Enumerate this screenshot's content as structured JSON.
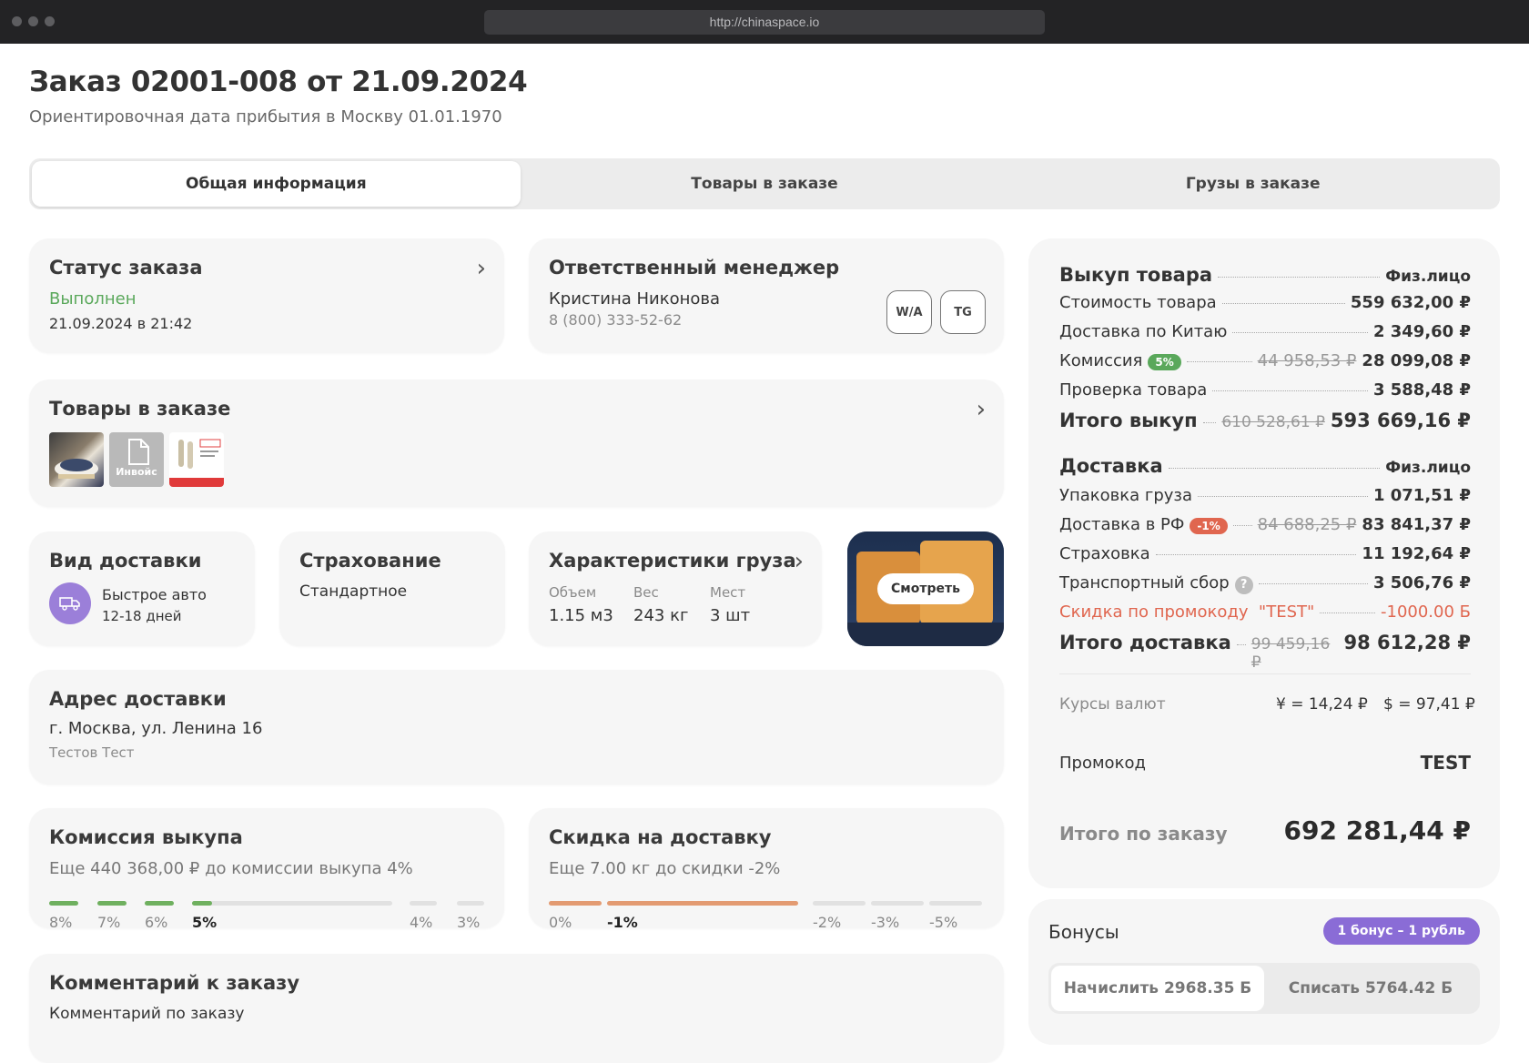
{
  "browser": {
    "url": "http://chinaspace.io"
  },
  "header": {
    "title": "Заказ 02001-008 от 21.09.2024",
    "subtitle": "Ориентировочная дата прибытия в Москву 01.01.1970"
  },
  "tabs": [
    {
      "label": "Общая информация",
      "active": true
    },
    {
      "label": "Товары в заказе",
      "active": false
    },
    {
      "label": "Грузы в заказе",
      "active": false
    }
  ],
  "status": {
    "title": "Статус заказа",
    "value": "Выполнен",
    "date": "21.09.2024 в 21:42"
  },
  "manager": {
    "title": "Ответственный менеджер",
    "name": "Кристина Никонова",
    "phone": "8 (800) 333-52-62",
    "btn_wa": "W/A",
    "btn_tg": "TG"
  },
  "goods": {
    "title": "Товары в заказе",
    "invoice_label": "Инвойс"
  },
  "delivery_type": {
    "title": "Вид доставки",
    "name": "Быстрое авто",
    "days": "12-18 дней"
  },
  "insurance": {
    "title": "Страхование",
    "value": "Стандартное"
  },
  "cargo": {
    "title": "Характеристики груза",
    "labels": [
      "Объем",
      "Вес",
      "Мест"
    ],
    "values": [
      "1.15 м3",
      "243 кг",
      "3 шт"
    ],
    "view_button": "Смотреть"
  },
  "address": {
    "title": "Адрес доставки",
    "line": "г. Москва, ул. Ленина 16",
    "recipient": "Тестов Тест"
  },
  "commission": {
    "title": "Комиссия выкупа",
    "note": "Еще 440 368,00 ₽ до комиссии выкупа 4%",
    "ticks": [
      "8%",
      "7%",
      "6%",
      "5%",
      "4%",
      "3%"
    ],
    "current": "5%"
  },
  "delivery_discount": {
    "title": "Скидка на доставку",
    "note": "Еще 7.00 кг до скидки -2%",
    "ticks": [
      "0%",
      "-1%",
      "-2%",
      "-3%",
      "-5%"
    ],
    "current": "-1%"
  },
  "comment": {
    "title": "Комментарий к заказу",
    "placeholder": "Комментарий по заказу"
  },
  "summary": {
    "purchase_title": "Выкуп товара",
    "purchase_type": "Физ.лицо",
    "goods_cost_label": "Стоимость товара",
    "goods_cost": "559 632,00 ₽",
    "china_delivery_label": "Доставка по Китаю",
    "china_delivery": "2 349,60 ₽",
    "commission_label": "Комиссия",
    "commission_badge": "5%",
    "commission_old": "44 958,53 ₽",
    "commission_value": "28 099,08 ₽",
    "check_label": "Проверка товара",
    "check_value": "3 588,48 ₽",
    "purchase_total_label": "Итого выкуп",
    "purchase_total_old": "610 528,61 ₽",
    "purchase_total": "593 669,16 ₽",
    "delivery_title": "Доставка",
    "delivery_type": "Физ.лицо",
    "packing_label": "Упаковка груза",
    "packing_value": "1 071,51 ₽",
    "rf_label": "Доставка в РФ",
    "rf_badge": "-1%",
    "rf_old": "84 688,25 ₽",
    "rf_value": "83 841,37 ₽",
    "ins_label": "Страховка",
    "ins_value": "11 192,64 ₽",
    "transport_label": "Транспортный сбор",
    "transport_value": "3 506,76 ₽",
    "promo_discount_label": "Скидка по промокоду  \"TEST\"",
    "promo_discount_value": "-1000.00 Б",
    "delivery_total_label": "Итого доставка",
    "delivery_total_old": "99 459,16 ₽",
    "delivery_total": "98 612,28 ₽",
    "rates_label": "Курсы валют",
    "rate_cny": "¥ = 14,24 ₽",
    "rate_usd": "$ = 97,41 ₽",
    "promo_label": "Промокод",
    "promo_value": "TEST",
    "order_total_label": "Итого по заказу",
    "order_total": "692 281,44 ₽"
  },
  "bonus": {
    "title": "Бонусы",
    "badge": "1 бонус – 1 рубль",
    "accrue": "Начислить 2968.35 Б",
    "spend": "Списать 5764.42 Б"
  },
  "colors": {
    "green": "#5aa85b",
    "red": "#e0664f",
    "purple": "#8a6cd6",
    "orange": "#e39b72"
  }
}
